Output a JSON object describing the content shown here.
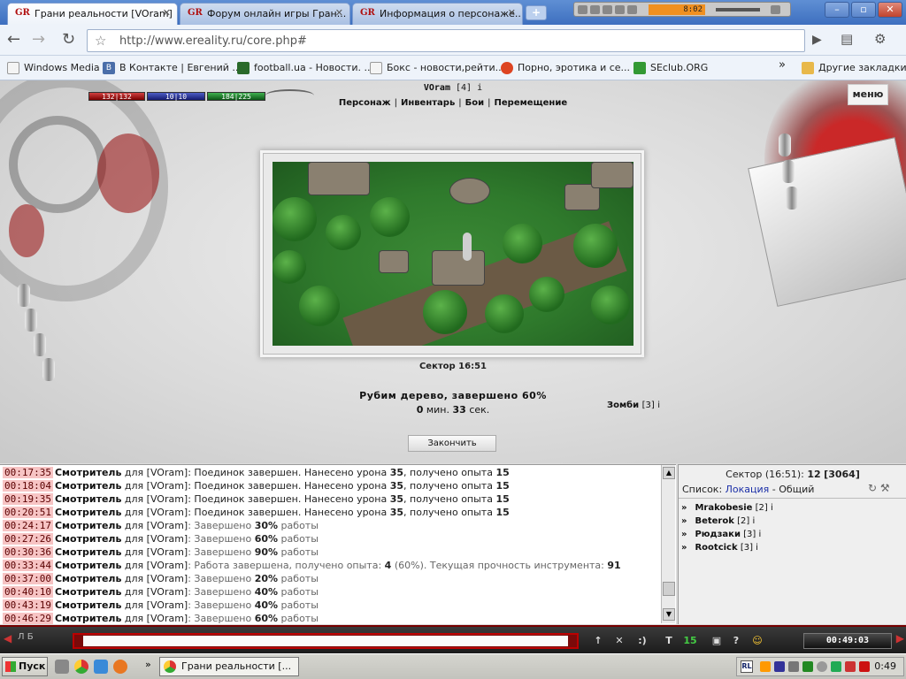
{
  "browser": {
    "tabs": [
      {
        "label": "Грани реальности [VOram]",
        "icon": "GR"
      },
      {
        "label": "Форум онлайн игры Гран...",
        "icon": "GR"
      },
      {
        "label": "Информация о персонаже...",
        "icon": "GR"
      }
    ],
    "new_tab": "+",
    "url": "http://www.ereality.ru/core.php#",
    "player_time": "8:02",
    "window_buttons": [
      "–",
      "▫",
      "✕"
    ],
    "bookmarks": [
      {
        "label": "Windows Media",
        "icon": "page-icon",
        "color": "#dddddd"
      },
      {
        "label": "В Контакте | Евгений ...",
        "icon": "vk-icon",
        "color": "#4a6ea9"
      },
      {
        "label": "football.ua - Новости. ...",
        "icon": "ball-icon",
        "color": "#2a6a2a"
      },
      {
        "label": "Бокс - новости,рейти...",
        "icon": "page-icon",
        "color": "#dddddd"
      },
      {
        "label": "Порно, эротика и се...",
        "icon": "circle-icon",
        "color": "#dd4422"
      },
      {
        "label": "SEclub.ORG",
        "icon": "se-icon",
        "color": "#339933"
      }
    ],
    "other_bookmarks": "Другие закладки",
    "overflow": "»"
  },
  "game": {
    "hp": "132|132",
    "mp": "10|10",
    "xp": "184|225",
    "char_name": "VOram",
    "char_level": "[4]",
    "info": "i",
    "nav": [
      "Персонаж",
      "Инвентарь",
      "Бои",
      "Перемещение"
    ],
    "nav_sep": "|",
    "menu": "меню",
    "sector": "Сектор 16:51",
    "status": "Рубим дерево, завершено 60%",
    "timer_min": "0",
    "timer_min_label": "мин.",
    "timer_sec": "33",
    "timer_sec_label": "сек.",
    "npc_name": "Зомби",
    "npc_level": "[3]",
    "finish_button": "Закончить"
  },
  "chat": {
    "messages": [
      {
        "time": "00:17:35",
        "who": "Смотритель",
        "prep": " для ",
        "target": "[VOram]",
        "text": ": Поединок завершен. Нанесено урона ",
        "a": "35",
        "mid": ", получено опыта ",
        "b": "15",
        "tail": "",
        "dim": false
      },
      {
        "time": "00:18:04",
        "who": "Смотритель",
        "prep": " для ",
        "target": "[VOram]",
        "text": ": Поединок завершен. Нанесено урона ",
        "a": "35",
        "mid": ", получено опыта ",
        "b": "15",
        "tail": "",
        "dim": false
      },
      {
        "time": "00:19:35",
        "who": "Смотритель",
        "prep": " для ",
        "target": "[VOram]",
        "text": ": Поединок завершен. Нанесено урона ",
        "a": "35",
        "mid": ", получено опыта ",
        "b": "15",
        "tail": "",
        "dim": false
      },
      {
        "time": "00:20:51",
        "who": "Смотритель",
        "prep": " для ",
        "target": "[VOram]",
        "text": ": Поединок завершен. Нанесено урона ",
        "a": "35",
        "mid": ", получено опыта ",
        "b": "15",
        "tail": "",
        "dim": false
      },
      {
        "time": "00:24:17",
        "who": "Смотритель",
        "prep": " для ",
        "target": "[VOram]",
        "text": ": Завершено ",
        "a": "30%",
        "mid": " работы",
        "b": "",
        "tail": "",
        "dim": true
      },
      {
        "time": "00:27:26",
        "who": "Смотритель",
        "prep": " для ",
        "target": "[VOram]",
        "text": ": Завершено ",
        "a": "60%",
        "mid": " работы",
        "b": "",
        "tail": "",
        "dim": true
      },
      {
        "time": "00:30:36",
        "who": "Смотритель",
        "prep": " для ",
        "target": "[VOram]",
        "text": ": Завершено ",
        "a": "90%",
        "mid": " работы",
        "b": "",
        "tail": "",
        "dim": true
      },
      {
        "time": "00:33:44",
        "who": "Смотритель",
        "prep": " для ",
        "target": "[VOram]",
        "text": ": Работа завершена, получено опыта: ",
        "a": "4",
        "mid": " (60%). Текущая прочность инструмента: ",
        "b": "91",
        "tail": "",
        "dim": true
      },
      {
        "time": "00:37:00",
        "who": "Смотритель",
        "prep": " для ",
        "target": "[VOram]",
        "text": ": Завершено ",
        "a": "20%",
        "mid": " работы",
        "b": "",
        "tail": "",
        "dim": true
      },
      {
        "time": "00:40:10",
        "who": "Смотритель",
        "prep": " для ",
        "target": "[VOram]",
        "text": ": Завершено ",
        "a": "40%",
        "mid": " работы",
        "b": "",
        "tail": "",
        "dim": true
      },
      {
        "time": "00:43:19",
        "who": "Смотритель",
        "prep": " для ",
        "target": "[VOram]",
        "text": ": Завершено ",
        "a": "40%",
        "mid": " работы",
        "b": "",
        "tail": "",
        "dim": true
      },
      {
        "time": "00:46:29",
        "who": "Смотритель",
        "prep": " для ",
        "target": "[VOram]",
        "text": ": Завершено ",
        "a": "60%",
        "mid": " работы",
        "b": "",
        "tail": "",
        "dim": true
      }
    ]
  },
  "panel": {
    "sector_label": "Сектор (16:51):",
    "sector_count": "12",
    "sector_total": "[3064]",
    "list_label": "Список:",
    "list_location": "Локация",
    "list_sep": " - ",
    "list_general": "Общий",
    "players": [
      {
        "name": "Mrakobesie",
        "level": "[2]"
      },
      {
        "name": "Beterok",
        "level": "[2]"
      },
      {
        "name": "Рюдзаки",
        "level": "[3]"
      },
      {
        "name": "Rootcick",
        "level": "[3]"
      }
    ],
    "chevron": "»"
  },
  "bottombar": {
    "lang": "Л  Б",
    "buttons": [
      "↑",
      "✕",
      ":)",
      "T",
      "15",
      "▣",
      "?",
      "☺"
    ],
    "clock": "00:49:03"
  },
  "taskbar": {
    "start": "Пуск",
    "task": "Грани реальности [...",
    "lang": "RL",
    "time": "0:49",
    "arrows": "»"
  }
}
